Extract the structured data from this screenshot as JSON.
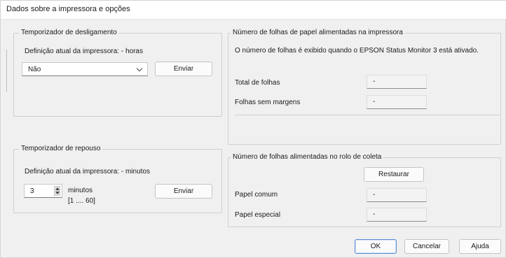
{
  "window": {
    "title": "Dados sobre a impressora e opções"
  },
  "shutdown_timer": {
    "group_title": "Temporizador de desligamento",
    "current_label": "Definição atual da impressora: - horas",
    "select_value": "Não",
    "send_label": "Enviar"
  },
  "sleep_timer": {
    "group_title": "Temporizador de repouso",
    "current_label": "Definição atual da impressora: - minutos",
    "value": "3",
    "unit": "minutos",
    "range": "[1 .... 60]",
    "send_label": "Enviar"
  },
  "paper_fed": {
    "group_title": "Número de folhas de papel alimentadas na impressora",
    "description": "O número de folhas é exibido quando o EPSON Status Monitor 3 está ativado.",
    "total_label": "Total de folhas",
    "total_value": "-",
    "borderless_label": "Folhas sem margens",
    "borderless_value": "-"
  },
  "roll_fed": {
    "group_title": "Número de folhas alimentadas no rolo de coleta",
    "reset_label": "Restaurar",
    "plain_label": "Papel comum",
    "plain_value": "-",
    "special_label": "Papel especial",
    "special_value": "-"
  },
  "footer": {
    "ok_label": "OK",
    "cancel_label": "Cancelar",
    "help_label": "Ajuda"
  }
}
